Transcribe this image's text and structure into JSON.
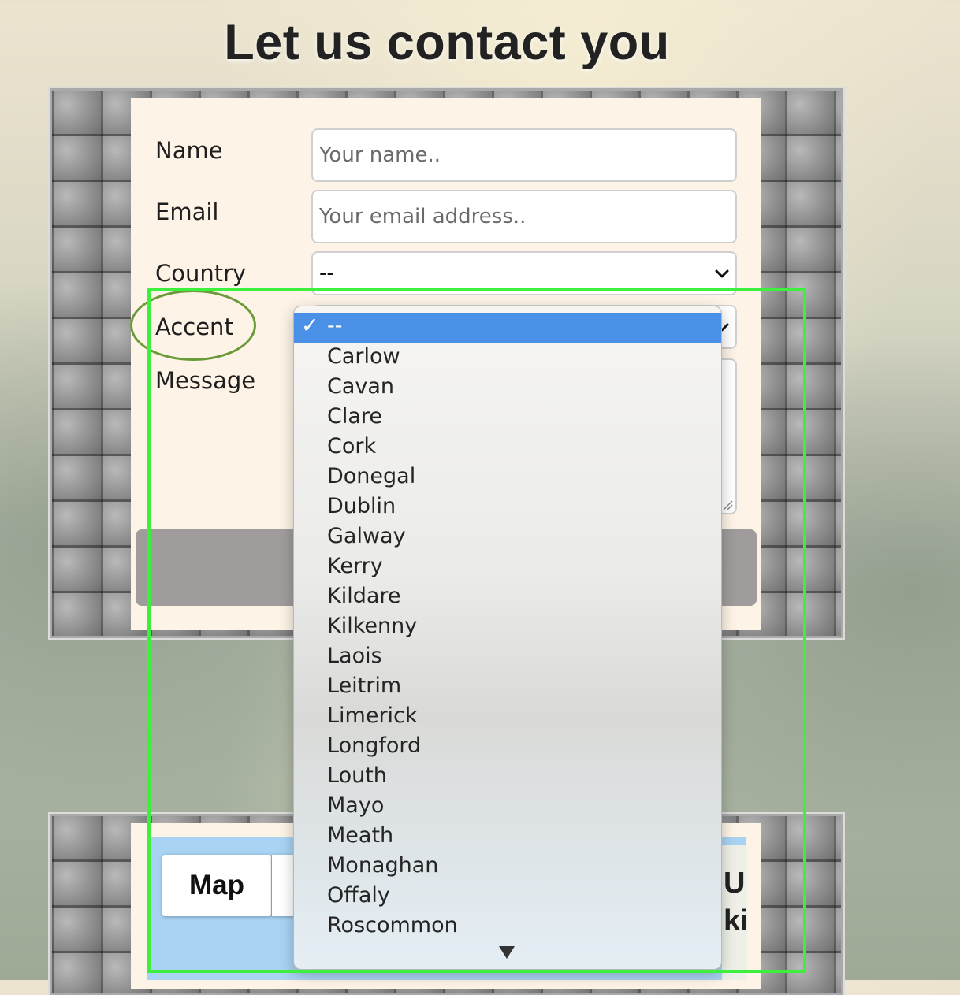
{
  "page": {
    "title": "Let us contact you"
  },
  "form": {
    "name_label": "Name",
    "name_placeholder": "Your name..",
    "email_label": "Email",
    "email_placeholder": "Your email address..",
    "country_label": "Country",
    "country_value": "--",
    "accent_label": "Accent",
    "message_label": "Message"
  },
  "accent_dropdown": {
    "selected": "--",
    "options": [
      "Carlow",
      "Cavan",
      "Clare",
      "Cork",
      "Donegal",
      "Dublin",
      "Galway",
      "Kerry",
      "Kildare",
      "Kilkenny",
      "Laois",
      "Leitrim",
      "Limerick",
      "Longford",
      "Louth",
      "Mayo",
      "Meath",
      "Monaghan",
      "Offaly",
      "Roscommon"
    ]
  },
  "map": {
    "map_button": "Map",
    "fragment_line1": "U",
    "fragment_line2": "ki"
  },
  "colors": {
    "highlight": "#4a90e6",
    "annotation_box": "#3ef03e",
    "annotation_circle": "#6a9a3a"
  }
}
